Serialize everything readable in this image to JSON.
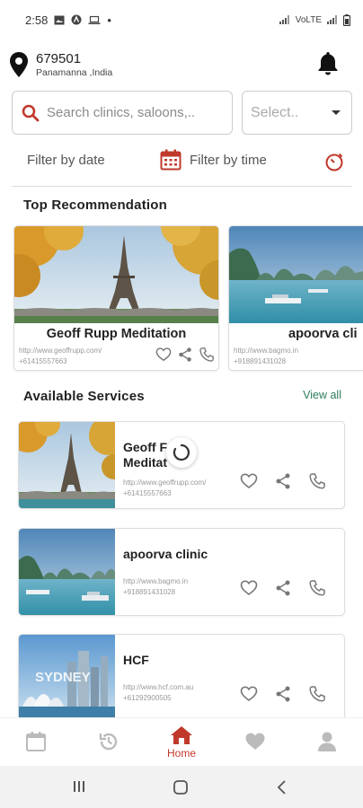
{
  "status_bar": {
    "time": "2:58",
    "dot": "•",
    "network": "VoLTE"
  },
  "location": {
    "code": "679501",
    "place": "Panamanna ,India"
  },
  "search": {
    "placeholder": "Search clinics, saloons,.."
  },
  "select": {
    "value": "Select.."
  },
  "filters": {
    "date_label": "Filter by date",
    "time_label": "Filter by time"
  },
  "recommendations": {
    "title": "Top Recommendation",
    "items": [
      {
        "name": "Geoff Rupp Meditation",
        "url": "http://www.geoffrupp.com/",
        "phone": "+61415557663",
        "image": "eiffel-tower"
      },
      {
        "name": "apoorva cli",
        "url": "http://www.bagmo.in",
        "phone": "+918891431028",
        "image": "bay-islands"
      }
    ]
  },
  "services": {
    "title": "Available Services",
    "view_all": "View all",
    "items": [
      {
        "name_line1": "Geoff F",
        "name_line2": "Meditat",
        "url": "http://www.geoffrupp.com/",
        "phone": "+61415557663",
        "image": "eiffel-tower"
      },
      {
        "name_line1": "apoorva clinic",
        "name_line2": "",
        "url": "http://www.bagmo.in",
        "phone": "+918891431028",
        "image": "bay-islands"
      },
      {
        "name_line1": "HCF",
        "name_line2": "",
        "url": "http://www.hcf.com.au",
        "phone": "+61292900505",
        "image": "sydney-opera-house",
        "image_text": "SYDNEY"
      }
    ]
  },
  "bottom_nav": {
    "items": [
      {
        "icon": "calendar-icon",
        "label": ""
      },
      {
        "icon": "history-icon",
        "label": ""
      },
      {
        "icon": "home-icon",
        "label": "Home",
        "active": true
      },
      {
        "icon": "heart-icon",
        "label": ""
      },
      {
        "icon": "user-icon",
        "label": ""
      }
    ]
  },
  "colors": {
    "accent": "#c0392b",
    "view_all": "#2e7d5b",
    "icon_gray": "#777777"
  }
}
